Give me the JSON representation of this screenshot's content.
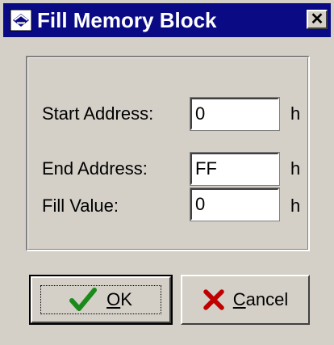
{
  "window": {
    "title": "Fill Memory Block",
    "close_glyph": "✕"
  },
  "fields": [
    {
      "label": "Start Address:",
      "value": "0",
      "unit": "h"
    },
    {
      "label": "End Address:",
      "value": "FF",
      "unit": "h"
    },
    {
      "label": "Fill Value:",
      "value": "0",
      "unit": "h"
    }
  ],
  "buttons": {
    "ok": {
      "label": "OK",
      "accel": "O",
      "rest": "K",
      "icon": "checkmark-icon"
    },
    "cancel": {
      "label": "Cancel",
      "accel": "C",
      "rest": "ancel",
      "icon": "cross-icon"
    }
  },
  "colors": {
    "titlebar": "#0a0a84",
    "face": "#d4d0c8",
    "check": "#1a8a1a",
    "cross": "#c00000"
  }
}
